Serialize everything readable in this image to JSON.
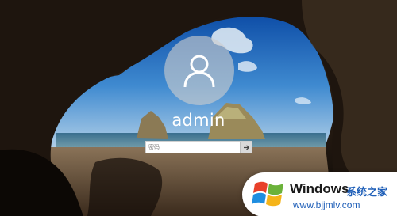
{
  "login": {
    "username": "admin",
    "password_placeholder": "密码",
    "submit_icon": "arrow-right-icon",
    "avatar_icon": "user-icon"
  },
  "watermark": {
    "title": "Windows",
    "subtitle": "系统之家",
    "url": "www.bjjmlv.com",
    "logo_icon": "windows-logo-icon"
  },
  "colors": {
    "sky": "#1f6fc0",
    "cave": "#2a1d14",
    "accent_blue": "#1f5fb8"
  }
}
